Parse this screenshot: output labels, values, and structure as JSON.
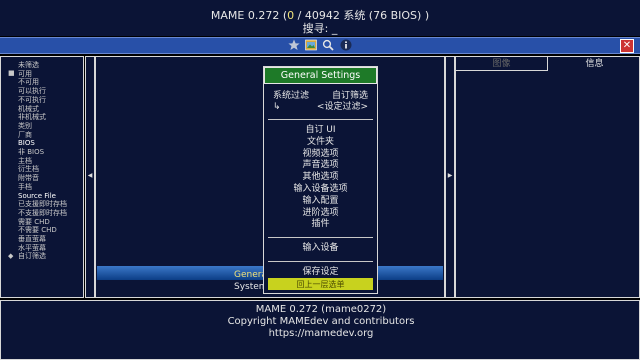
{
  "header": {
    "title_pre": "MAME 0.272 (",
    "title_hl": "0",
    "title_post": " / 40942 系统 (76 BIOS) )",
    "search_label": "搜寻: _"
  },
  "toolbar": {
    "favorite_icon": "star-icon",
    "image_icon": "picture-icon",
    "search_icon": "magnifier-icon",
    "info_icon": "info-icon",
    "close_icon": "close-icon",
    "close_glyph": "✕"
  },
  "left": {
    "items": [
      "未筛选",
      "可用",
      "不可用",
      "可以执行",
      "不可执行",
      "机械式",
      "非机械式",
      "类别",
      "厂商",
      "BIOS",
      "非 BIOS",
      "主档",
      "衍生档",
      "附带音",
      "手档",
      "Source File",
      "已支援即时存档",
      "不支援即时存档",
      "需要 CHD",
      "不需要 CHD",
      "垂直萤幕",
      "水平萤幕",
      "自订筛选"
    ]
  },
  "arrows": {
    "left": "◀",
    "right": "▶"
  },
  "middle": {
    "row1": "General Settings",
    "row2": "System Filter"
  },
  "right": {
    "tab_image": "图像",
    "tab_info": "信息"
  },
  "footer": {
    "line1": "MAME 0.272 (mame0272)",
    "line2": "Copyright MAMEdev and contributors",
    "line3": "https://mamedev.org"
  },
  "modal": {
    "title": "General Settings",
    "filter_label": "系统过滤",
    "filter_value": "自订筛选",
    "filter_arrow": "↳",
    "custom_filter": "<设定过滤>",
    "items": [
      "自订 UI",
      "文件夹",
      "视频选项",
      "声音选项",
      "其他选项",
      "输入设备选项",
      "输入配置",
      "进阶选项",
      "插件"
    ],
    "input_devices": "输入设备",
    "save": "保存设定",
    "back": "回上一层选单"
  },
  "colors": {
    "panel_bg": "#0b1436",
    "toolbar_bg": "#2850a8",
    "modal_title_bg": "#1e7a28",
    "selected_bg": "#c8d21e",
    "highlight_text": "#f0e27a"
  }
}
